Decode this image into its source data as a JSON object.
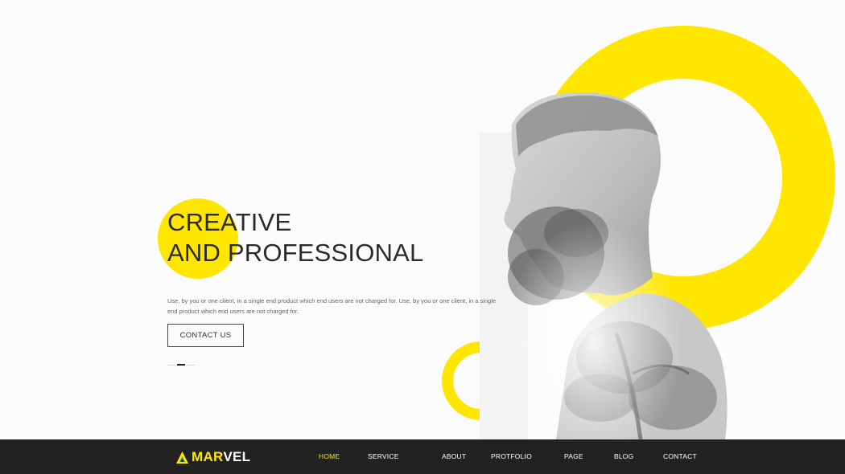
{
  "hero": {
    "title_line1": "CREATIVE",
    "title_line2": "AND PROFESSIONAL",
    "description": "Use, by you or one client, in a single end product which end users are not charged for. Use, by you or one client, in a single end product which end users are not charged for.",
    "cta_label": "CONTACT US",
    "slide_count": 3,
    "active_slide": 2
  },
  "nav": {
    "logo_part1": "MAR",
    "logo_part2": "VEL",
    "items": [
      "HOME",
      "SERVICE",
      "ABOUT",
      "PROTFOLIO",
      "PAGE",
      "BLOG",
      "CONTACT"
    ],
    "active_item": "HOME"
  },
  "colors": {
    "accent": "#ffe600",
    "navbar_bg": "#222222",
    "text_dark": "#2b2b2b"
  },
  "icons": {
    "logo_icon": "triangle-logo-icon"
  }
}
